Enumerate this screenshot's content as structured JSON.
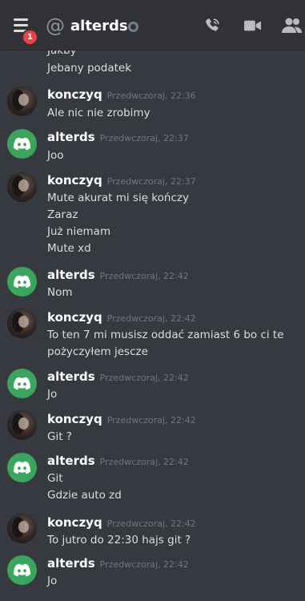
{
  "header": {
    "title": "alterds",
    "notification_count": "1",
    "icons": [
      "menu-icon",
      "at-icon",
      "status-icon",
      "phone-call-icon",
      "video-call-icon",
      "members-icon"
    ]
  },
  "colors": {
    "background": "#36393f",
    "topbar": "#303237",
    "badge": "#ed4245",
    "discord_avatar_green": "#3ba55d"
  },
  "messages": [
    {
      "lines": [
        "Jakby",
        "Jebany podatek"
      ]
    },
    {
      "author": "konczyq",
      "timestamp": "Przedwczoraj, 22:36",
      "avatar": "photo",
      "lines": [
        "Ale nic nie zrobimy"
      ]
    },
    {
      "author": "alterds",
      "timestamp": "Przedwczoraj, 22:37",
      "avatar": "discord-logo",
      "lines": [
        "Joo"
      ]
    },
    {
      "author": "konczyq",
      "timestamp": "Przedwczoraj, 22:37",
      "avatar": "photo",
      "lines": [
        "Mute akurat mi się kończy",
        "Zaraz",
        "Już niemam",
        "Mute xd"
      ]
    },
    {
      "author": "alterds",
      "timestamp": "Przedwczoraj, 22:42",
      "avatar": "discord-logo",
      "lines": [
        "Nom"
      ]
    },
    {
      "author": "konczyq",
      "timestamp": "Przedwczoraj, 22:42",
      "avatar": "photo",
      "lines": [
        "To ten 7 mi musisz oddać zamiast 6 bo ci te",
        "pożyczyłem jescze"
      ]
    },
    {
      "author": "alterds",
      "timestamp": "Przedwczoraj, 22:42",
      "avatar": "discord-logo",
      "lines": [
        "Jo"
      ]
    },
    {
      "author": "konczyq",
      "timestamp": "Przedwczoraj, 22:42",
      "avatar": "photo",
      "lines": [
        "Git ?"
      ]
    },
    {
      "author": "alterds",
      "timestamp": "Przedwczoraj, 22:42",
      "avatar": "discord-logo",
      "lines": [
        "Git",
        "Gdzie auto zd"
      ]
    },
    {
      "author": "konczyq",
      "timestamp": "Przedwczoraj, 22:42",
      "avatar": "photo",
      "lines": [
        "To jutro do 22:30 hajs git ?"
      ]
    },
    {
      "author": "alterds",
      "timestamp": "Przedwczoraj, 22:42",
      "avatar": "discord-logo",
      "lines": [
        "Jo"
      ]
    }
  ]
}
